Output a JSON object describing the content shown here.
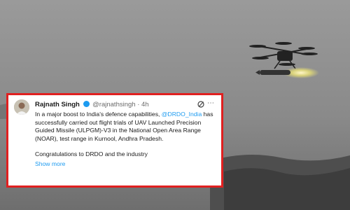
{
  "tweet": {
    "author_name": "Rajnath Singh",
    "handle": "@rajnathsingh",
    "separator": "·",
    "time": "4h",
    "text_before_mention": "In a major boost to India's defence capabilities, ",
    "mention": "@DRDO_India",
    "text_after_mention": " has successfully carried out flight trials of UAV Launched Precision Guided Missile (ULPGM)-V3 in the National Open Area Range (NOAR), test range in Kurnool, Andhra Pradesh.",
    "second_paragraph": "Congratulations to DRDO and the industry",
    "show_more": "Show more"
  },
  "colors": {
    "accent_blue": "#1d9bf0",
    "border_red": "#e02020"
  },
  "icons": [
    "verified-icon",
    "grok-icon",
    "more-icon"
  ]
}
